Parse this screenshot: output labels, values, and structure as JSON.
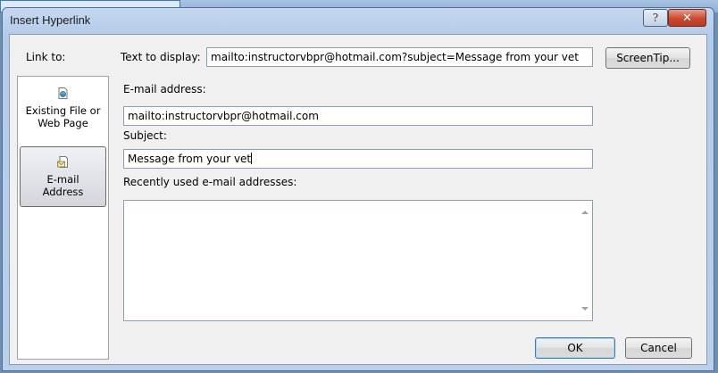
{
  "dialog": {
    "title": "Insert Hyperlink",
    "help_glyph": "?",
    "close_glyph": "✕"
  },
  "link_to": {
    "label": "Link to:",
    "items": [
      {
        "line1": "Existing File or",
        "line2": "Web Page",
        "icon": "web-page-icon"
      },
      {
        "line1": "E-mail",
        "line2": "Address",
        "icon": "email-address-icon",
        "selected": true
      }
    ]
  },
  "fields": {
    "text_to_display_label": "Text to display:",
    "text_to_display_value": "mailto:instructorvbpr@hotmail.com?subject=Message from your vet",
    "email_address_label": "E-mail address:",
    "email_address_value": "mailto:instructorvbpr@hotmail.com",
    "subject_label": "Subject:",
    "subject_value": "Message from your vet",
    "recent_label": "Recently used e-mail addresses:"
  },
  "buttons": {
    "screentip": "ScreenTip...",
    "ok": "OK",
    "cancel": "Cancel"
  },
  "colors": {
    "title_bar": "#b9cfec",
    "close_button": "#c94a2f",
    "default_button_border": "#3c7fb1"
  }
}
